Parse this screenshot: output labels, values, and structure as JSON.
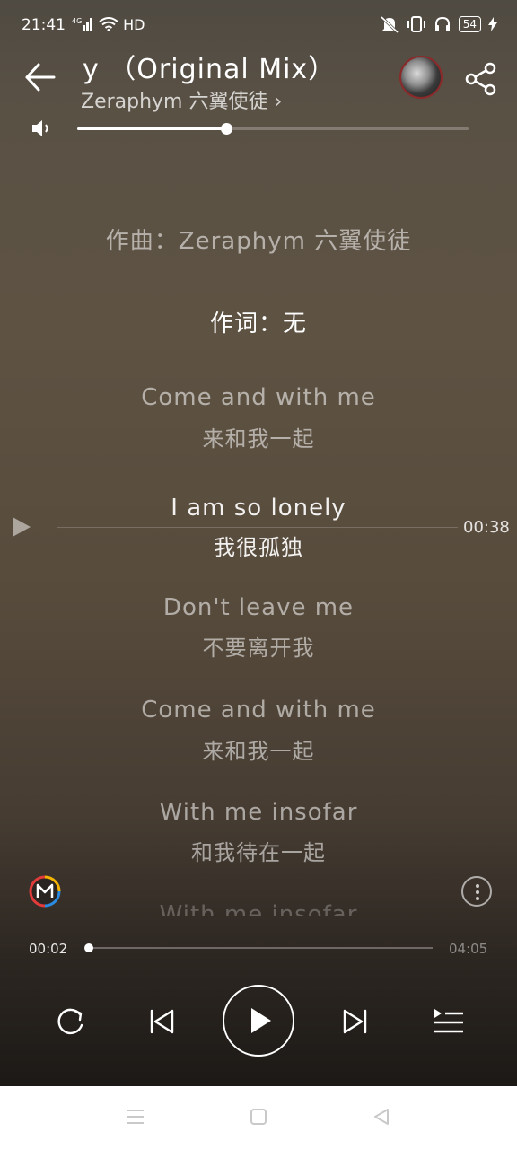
{
  "status_bar": {
    "time": "21:41",
    "signal_label": "4G",
    "network": "HD",
    "battery": "54"
  },
  "song": {
    "title": "y （Original Mix）",
    "artist": "Zeraphym 六翼使徒 ›"
  },
  "volume": {
    "level": 0.38
  },
  "lyrics": [
    {
      "text": "作曲：Zeraphym 六翼使徒",
      "translation": ""
    },
    {
      "text": "作词：无",
      "translation": ""
    },
    {
      "text": "Come and with me",
      "translation": "来和我一起"
    },
    {
      "text": "I am so lonely",
      "translation": "我很孤独"
    },
    {
      "text": "Don't leave me",
      "translation": "不要离开我"
    },
    {
      "text": "Come and with me",
      "translation": "来和我一起"
    },
    {
      "text": "With me insofar",
      "translation": "和我待在一起"
    },
    {
      "text": "With me insofar",
      "translation": ""
    }
  ],
  "seek_marker": {
    "time": "00:38"
  },
  "progress": {
    "current": "00:02",
    "total": "04:05",
    "fraction": 0.008
  },
  "colors": {
    "accent": "#ffffff",
    "background_top": "#4f4a42",
    "background_bottom": "#1c1916"
  }
}
